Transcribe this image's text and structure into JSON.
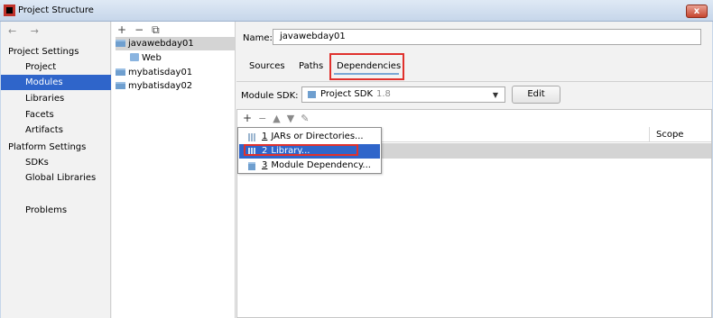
{
  "window": {
    "title": "Project Structure",
    "close_label": "x"
  },
  "nav": {
    "back_forward": "← →",
    "project_settings_header": "Project Settings",
    "project_settings": [
      "Project",
      "Modules",
      "Libraries",
      "Facets",
      "Artifacts"
    ],
    "platform_settings_header": "Platform Settings",
    "platform_settings": [
      "SDKs",
      "Global Libraries"
    ],
    "problems": "Problems",
    "selected": "Modules"
  },
  "tree": {
    "toolbar": [
      "+",
      "−",
      "⧉"
    ],
    "nodes": [
      "javawebday01",
      "Web",
      "mybatisday01",
      "mybatisday02"
    ],
    "selected": "javawebday01"
  },
  "panel": {
    "name_label": "Name:",
    "name_value": "javawebday01",
    "tabs": [
      "Sources",
      "Paths",
      "Dependencies"
    ],
    "active_tab": "Dependencies",
    "module_sdk_label": "Module SDK:",
    "sdk_value": "Project SDK",
    "sdk_version": "1.8",
    "edit_button": "Edit",
    "deps_toolbar": [
      "+",
      "−",
      "▲",
      "▼",
      "✎"
    ],
    "scope_header": "Scope"
  },
  "popup": {
    "items": [
      {
        "num": "1",
        "label": "JARs or Directories..."
      },
      {
        "num": "2",
        "label": "Library..."
      },
      {
        "num": "3",
        "label": "Module Dependency..."
      }
    ],
    "highlighted": "Library..."
  },
  "colors": {
    "selection": "#2f65ca",
    "annotation_red": "#e0312d"
  }
}
